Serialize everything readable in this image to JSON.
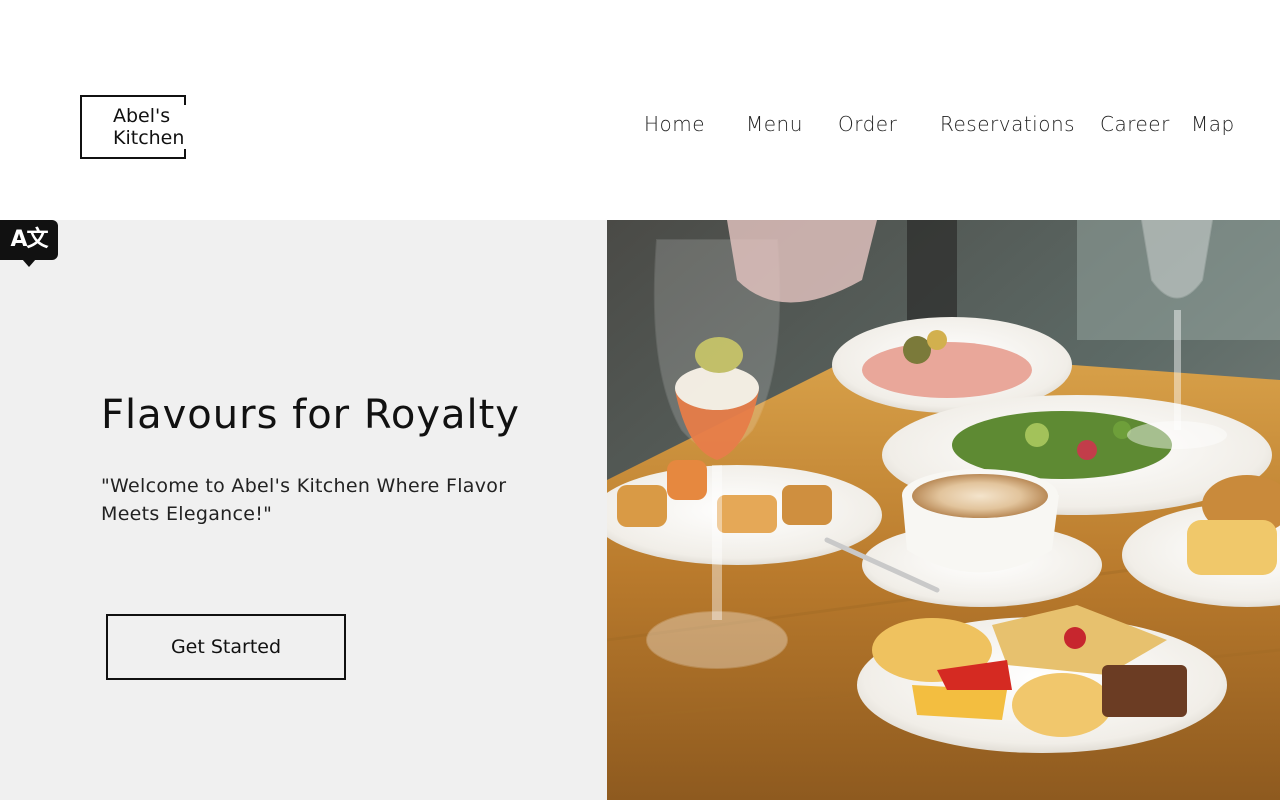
{
  "brand": {
    "line1": "Abel's",
    "line2": "Kitchen"
  },
  "nav": {
    "items": [
      {
        "label": "Home"
      },
      {
        "label": "Menu"
      },
      {
        "label": "Order"
      },
      {
        "label": "Reservations"
      },
      {
        "label": "Career"
      },
      {
        "label": "Map"
      }
    ]
  },
  "translate": {
    "icon": "translate-icon",
    "glyph": "A文"
  },
  "hero": {
    "title": "Flavours for Royalty",
    "subtitle": "\"Welcome to Abel's Kitchen Where Flavor Meets Elegance!\"",
    "cta_label": "Get Started"
  },
  "colors": {
    "panel": "#f0f0f0",
    "text": "#111111",
    "table": "#b8802e"
  }
}
